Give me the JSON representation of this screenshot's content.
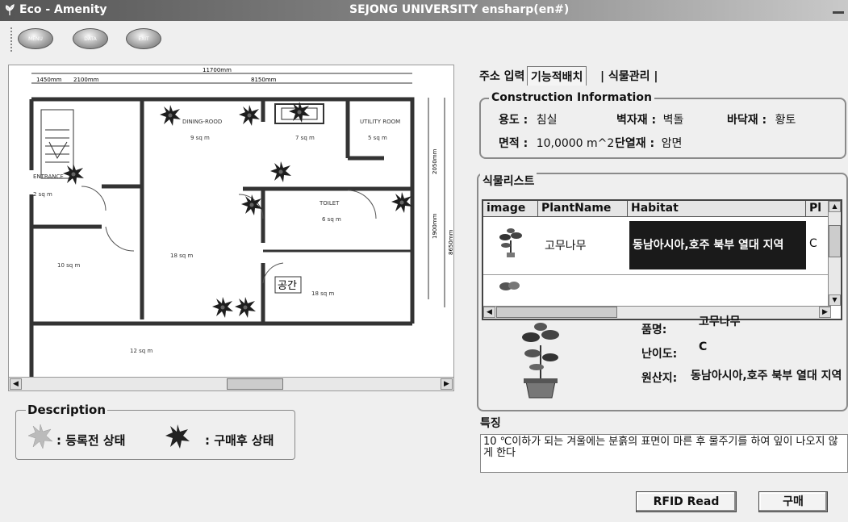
{
  "window": {
    "app_title": "Eco - Amenity",
    "center_title": "SEJONG UNIVERSITY ensharp(en#)"
  },
  "toolbar": {
    "buttons": [
      {
        "label": "MENU"
      },
      {
        "label": "DATA"
      },
      {
        "label": "EXIT"
      }
    ]
  },
  "floorplan": {
    "dimensions": {
      "top_total": "11700mm",
      "top_left_a": "1450mm",
      "top_left_b": "2100mm",
      "top_right": "8150mm",
      "right_a": "2050mm",
      "right_b": "1900mm",
      "right_total": "8650mm"
    },
    "rooms": {
      "dining": "DINING-ROOD",
      "dining_area": "9 sq m",
      "middle_area": "7 sq m",
      "utility": "UTILITY ROOM",
      "utility_area": "5 sq m",
      "entrance": "ENTRANCE",
      "entrance_area": "2 sq m",
      "toilet": "TOILET",
      "toilet_area": "6 sq m",
      "living_area": "18 sq m",
      "left_room_area": "10 sq m",
      "right_room_area": "18 sq m",
      "bottom_room_area": "12 sq m"
    },
    "space_label": "공간"
  },
  "description": {
    "legend": "Description",
    "before_label": ": 등록전 상태",
    "after_label": ": 구매후 상태"
  },
  "tabs": [
    {
      "label": "주소 입력"
    },
    {
      "label": "기능적배치"
    },
    {
      "label": "식물관리"
    }
  ],
  "active_tab": "기능적배치",
  "construction": {
    "legend": "Construction Information",
    "use_label": "용도 :",
    "use_value": "침실",
    "wall_label": "벽자재 :",
    "wall_value": "벽돌",
    "floor_label": "바닥재 :",
    "floor_value": "황토",
    "area_label": "면적 :",
    "area_value": "10,0000 m^2",
    "insulation_label": "단열재 :",
    "insulation_value": "암면"
  },
  "plant_list": {
    "legend": "식물리스트",
    "columns": [
      "image",
      "PlantName",
      "Habitat",
      "Pl"
    ],
    "rows": [
      {
        "name": "고무나무",
        "habitat": "동남아시아,호주 북부 열대 지역",
        "level": "C",
        "selected": true
      },
      {
        "name": "",
        "habitat": "",
        "level": "",
        "selected": false
      }
    ]
  },
  "detail": {
    "name_label": "품명:",
    "name_value": "고무나무",
    "difficulty_label": "난이도:",
    "difficulty_value": "C",
    "origin_label": "원산지:",
    "origin_value": "동남아시아,호주 북부 열대 지역"
  },
  "feature": {
    "label": "특징",
    "text": "10 ℃이하가 되는 겨울에는 분흙의 표면이 마른 후 물주기를 하여 잎이 나오지 않게 한다"
  },
  "buttons": {
    "rfid": "RFID Read",
    "buy": "구매"
  },
  "colors": {
    "plant_dark": "#222222",
    "plant_light": "#bbbbbb",
    "selection": "#1a1a1a"
  }
}
